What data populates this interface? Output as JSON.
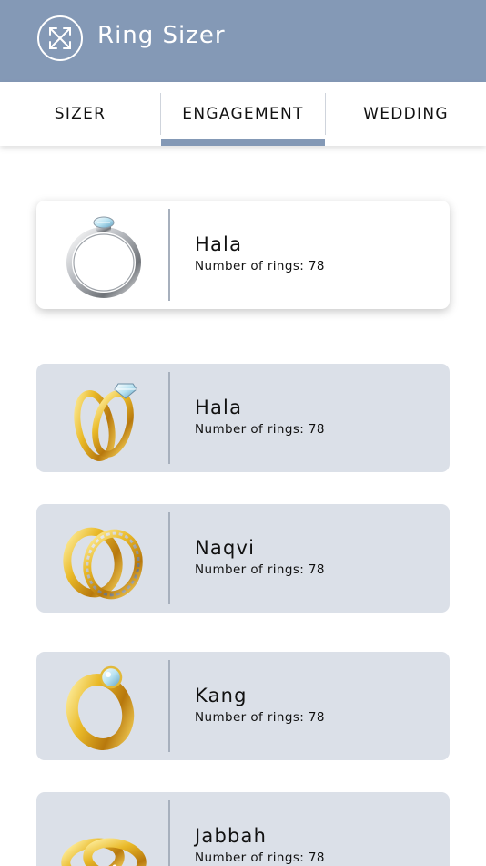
{
  "app": {
    "title": "Ring Sizer",
    "accent_color": "#8499b6",
    "logo_icon": "resize-arrows-icon"
  },
  "tabs": [
    {
      "label": "SIZER",
      "active": false
    },
    {
      "label": "ENGAGEMENT",
      "active": true
    },
    {
      "label": "WEDDING",
      "active": false
    }
  ],
  "rings": [
    {
      "name": "Hala",
      "count_text": "Number of rings: 78",
      "selected": true,
      "icon": "silver-diamond-ring-icon"
    },
    {
      "name": "Hala",
      "count_text": "Number of rings: 78",
      "selected": false,
      "icon": "gold-ring-pair-diamond-icon"
    },
    {
      "name": "Naqvi",
      "count_text": "Number of rings: 78",
      "selected": false,
      "icon": "gold-silver-ring-pair-icon"
    },
    {
      "name": "Kang",
      "count_text": "Number of rings: 78",
      "selected": false,
      "icon": "gold-diamond-ring-icon"
    },
    {
      "name": "Jabbah",
      "count_text": "Number of rings: 78",
      "selected": false,
      "icon": "gold-band-pair-icon"
    }
  ]
}
